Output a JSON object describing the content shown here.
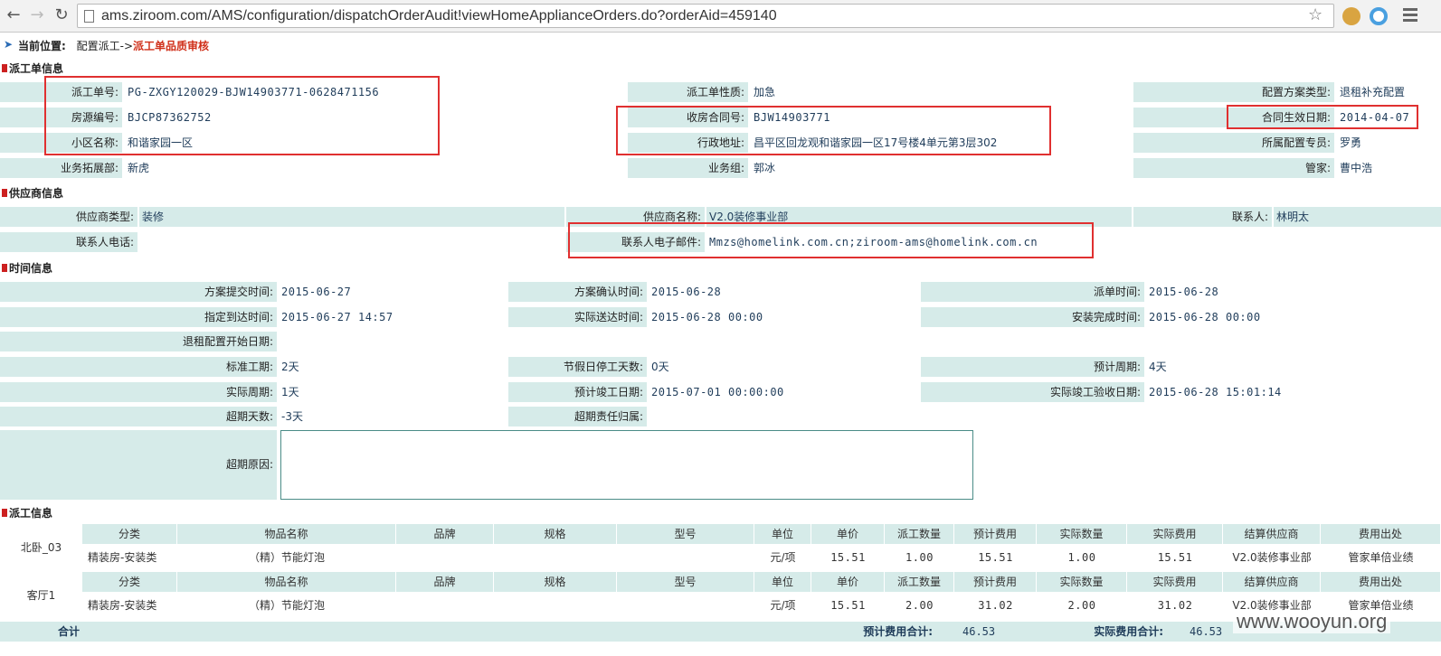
{
  "browser": {
    "url": "ams.ziroom.com/AMS/configuration/dispatchOrderAudit!viewHomeApplianceOrders.do?orderAid=459140"
  },
  "breadcrumb": {
    "prefix": "当前位置:",
    "path": "配置派工->",
    "current": "派工单品质审核"
  },
  "sections": {
    "order": "派工单信息",
    "supplier": "供应商信息",
    "time": "时间信息",
    "dispatch": "派工信息"
  },
  "order_info": {
    "order_no_label": "派工单号:",
    "order_no": "PG-ZXGY120029-BJW14903771-0628471156",
    "nature_label": "派工单性质:",
    "nature": "加急",
    "plan_type_label": "配置方案类型:",
    "plan_type": "退租补充配置",
    "house_no_label": "房源编号:",
    "house_no": "BJCP87362752",
    "contract_label": "收房合同号:",
    "contract": "BJW14903771",
    "effective_label": "合同生效日期:",
    "effective": "2014-04-07",
    "community_label": "小区名称:",
    "community": "和谐家园一区",
    "address_label": "行政地址:",
    "address": "昌平区回龙观和谐家园一区17号楼4单元第3层302",
    "specialist_label": "所属配置专员:",
    "specialist": "罗勇",
    "dept_label": "业务拓展部:",
    "dept": "新虎",
    "group_label": "业务组:",
    "group": "郭冰",
    "steward_label": "管家:",
    "steward": "曹中浩"
  },
  "supplier_info": {
    "type_label": "供应商类型:",
    "type": "装修",
    "name_label": "供应商名称:",
    "name": "V2.0装修事业部",
    "contact_label": "联系人:",
    "contact": "林明太",
    "phone_label": "联系人电话:",
    "phone": "",
    "email_label": "联系人电子邮件:",
    "email": "Mmzs@homelink.com.cn;ziroom-ams@homelink.com.cn"
  },
  "time_info": {
    "submit_label": "方案提交时间:",
    "submit": "2015-06-27",
    "confirm_label": "方案确认时间:",
    "confirm": "2015-06-28",
    "dispatch_label": "派单时间:",
    "dispatch": "2015-06-28",
    "arrive_label": "指定到达时间:",
    "arrive": "2015-06-27 14:57",
    "delivered_label": "实际送达时间:",
    "delivered": "2015-06-28 00:00",
    "installed_label": "安装完成时间:",
    "installed": "2015-06-28 00:00",
    "refund_start_label": "退租配置开始日期:",
    "refund_start": "",
    "std_period_label": "标准工期:",
    "std_period": "2天",
    "holiday_label": "节假日停工天数:",
    "holiday": "0天",
    "est_period_label": "预计周期:",
    "est_period": "4天",
    "actual_period_label": "实际周期:",
    "actual_period": "1天",
    "est_finish_label": "预计竣工日期:",
    "est_finish": "2015-07-01 00:00:00",
    "actual_accept_label": "实际竣工验收日期:",
    "actual_accept": "2015-06-28 15:01:14",
    "overdue_days_label": "超期天数:",
    "overdue_days": "-3天",
    "overdue_resp_label": "超期责任归属:",
    "overdue_resp": "",
    "overdue_reason_label": "超期原因:",
    "overdue_reason": ""
  },
  "dispatch_table": {
    "headers": [
      "分类",
      "物品名称",
      "品牌",
      "规格",
      "型号",
      "单位",
      "单价",
      "派工数量",
      "预计费用",
      "实际数量",
      "实际费用",
      "结算供应商",
      "费用出处"
    ],
    "rooms": [
      {
        "room": "北卧_03",
        "row": [
          "精装房-安装类",
          "（精）节能灯泡",
          "",
          "",
          "",
          "元/项",
          "15.51",
          "1.00",
          "15.51",
          "1.00",
          "15.51",
          "V2.0装修事业部",
          "管家单倍业绩"
        ]
      },
      {
        "room": "客厅1",
        "row": [
          "精装房-安装类",
          "（精）节能灯泡",
          "",
          "",
          "",
          "元/项",
          "15.51",
          "2.00",
          "31.02",
          "2.00",
          "31.02",
          "V2.0装修事业部",
          "管家单倍业绩"
        ]
      }
    ],
    "total_label": "合计",
    "est_total_label": "预计费用合计:",
    "est_total": "46.53",
    "actual_total_label": "实际费用合计:",
    "actual_total": "46.53"
  },
  "watermark": "www.wooyun.org"
}
